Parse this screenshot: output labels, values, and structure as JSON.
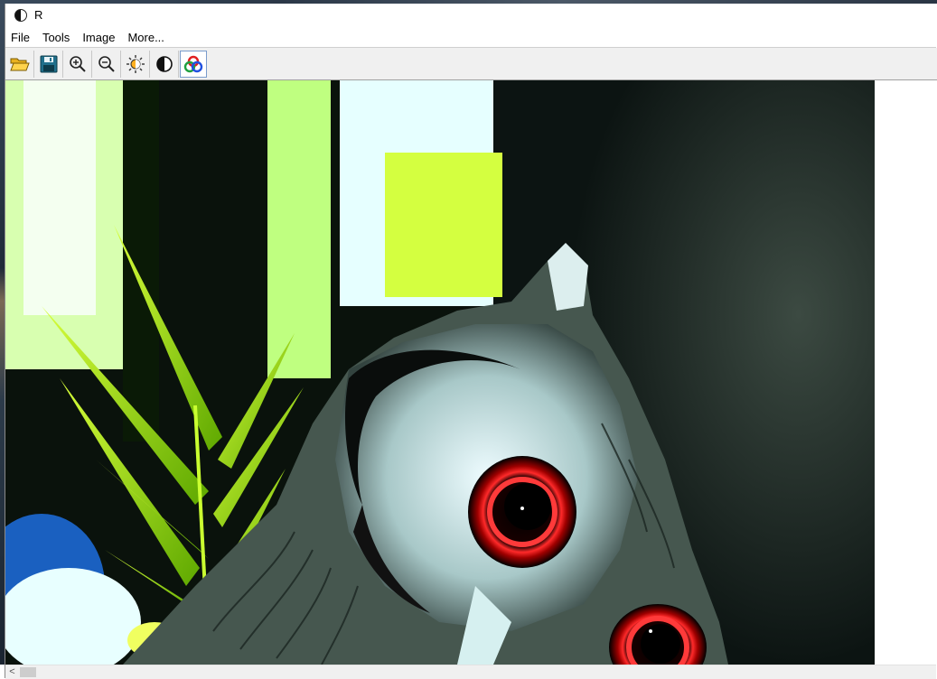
{
  "window": {
    "title": "R"
  },
  "menu": {
    "items": [
      "File",
      "Tools",
      "Image",
      "More..."
    ]
  },
  "toolbar": {
    "buttons": [
      {
        "icon": "open-folder-icon"
      },
      {
        "icon": "save-icon"
      },
      {
        "icon": "zoom-in-icon"
      },
      {
        "icon": "zoom-out-icon"
      },
      {
        "icon": "brightness-icon"
      },
      {
        "icon": "contrast-icon"
      },
      {
        "icon": "color-channels-icon",
        "active": true
      }
    ]
  },
  "image": {
    "subject": "owl-photo"
  },
  "scrollbar": {
    "left_arrow": "<"
  }
}
